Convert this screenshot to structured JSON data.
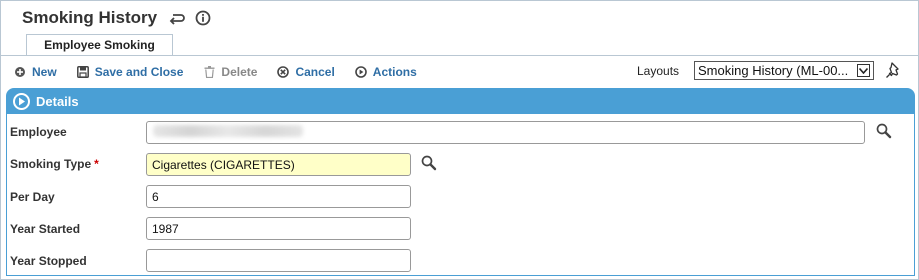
{
  "page": {
    "title": "Smoking History"
  },
  "tabs": [
    {
      "label": "Employee Smoking"
    }
  ],
  "toolbar": {
    "new_label": "New",
    "save_close_label": "Save and Close",
    "delete_label": "Delete",
    "cancel_label": "Cancel",
    "actions_label": "Actions"
  },
  "layouts": {
    "label": "Layouts",
    "selected": "Smoking History (ML-00..."
  },
  "section": {
    "title": "Details"
  },
  "fields": {
    "employee": {
      "label": "Employee",
      "value": ""
    },
    "smoking_type": {
      "label": "Smoking Type",
      "required_mark": "*",
      "value": "Cigarettes (CIGARETTES)"
    },
    "per_day": {
      "label": "Per Day",
      "value": "6"
    },
    "year_started": {
      "label": "Year Started",
      "value": "1987"
    },
    "year_stopped": {
      "label": "Year Stopped",
      "value": ""
    }
  },
  "colors": {
    "accent": "#4a9fd5",
    "link": "#2f6ea5",
    "required_bg": "#ffffc8",
    "required_mark": "#cc0000"
  },
  "icons": {
    "title_back": "return-arrow-icon",
    "title_info": "info-icon",
    "new": "plus-circle-icon",
    "save": "save-icon",
    "delete": "trash-icon",
    "cancel": "x-circle-icon",
    "actions": "play-circle-icon",
    "pin": "pin-icon",
    "lookup": "search-icon",
    "section": "play-circle-icon"
  }
}
